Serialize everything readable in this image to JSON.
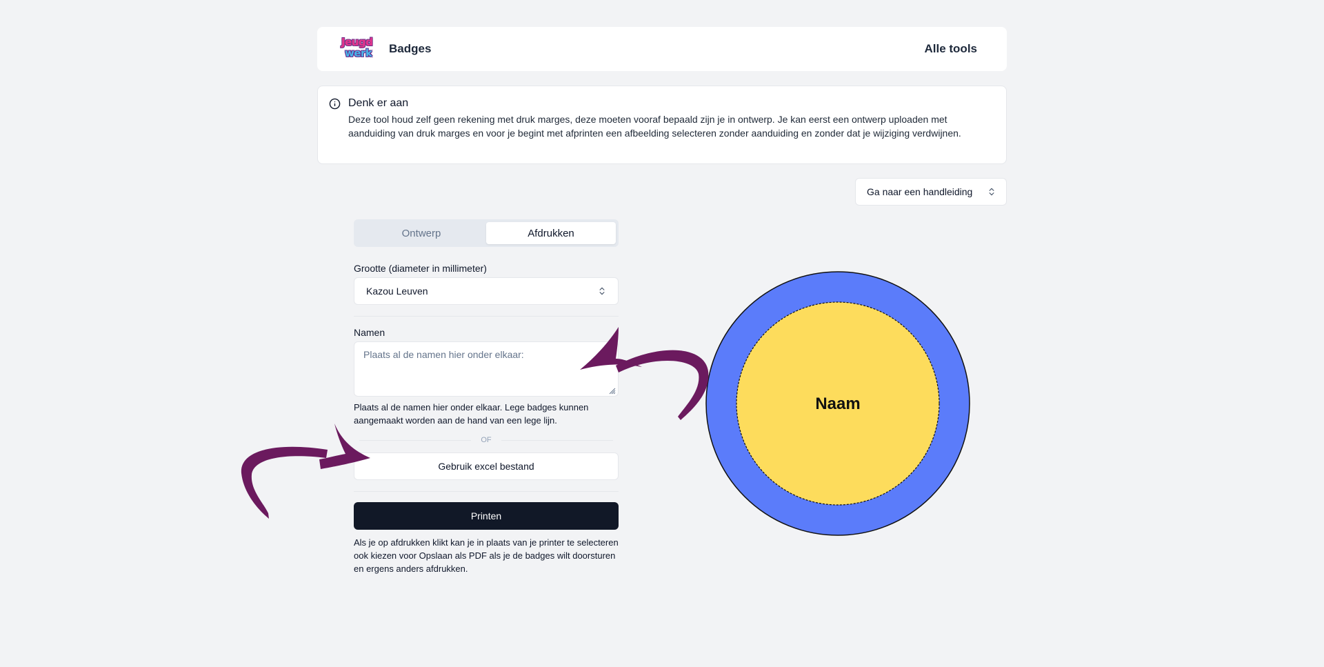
{
  "header": {
    "logo": {
      "line1": "Jeugd",
      "line2": "werk"
    },
    "title": "Badges",
    "nav_link": "Alle tools"
  },
  "notice": {
    "icon": "info-circle-icon",
    "title": "Denk er aan",
    "body": "Deze tool houd zelf geen rekening met druk marges, deze moeten vooraf bepaald zijn je in ontwerp. Je kan eerst een ontwerp uploaden met aanduiding van druk marges en voor je begint met afprinten een afbeelding selecteren zonder aanduiding en zonder dat je wijziging verdwijnen."
  },
  "guide_select": {
    "value": "Ga naar een handleiding",
    "icon": "chevron-up-down-icon"
  },
  "tabs": [
    {
      "label": "Ontwerp",
      "active": false
    },
    {
      "label": "Afdrukken",
      "active": true
    }
  ],
  "form": {
    "size_label": "Grootte (diameter in millimeter)",
    "size_value": "Kazou Leuven",
    "names_label": "Namen",
    "names_placeholder": "Plaats al de namen hier onder elkaar:",
    "names_value": "",
    "names_help": "Plaats al de namen hier onder elkaar. Lege badges kunnen aangemaakt worden aan de hand van een lege lijn.",
    "or_text": "OF",
    "excel_button": "Gebruik excel bestand",
    "print_button": "Printen",
    "print_help": "Als je op afdrukken klikt kan je in plaats van je printer te selecteren ook kiezen voor Opslaan als PDF als je de badges wilt doorsturen en ergens anders afdrukken."
  },
  "badge": {
    "text": "Naam",
    "outer_color": "#5b7cfa",
    "inner_color": "#fddc5c"
  },
  "colors": {
    "arrow": "#6b1a5e",
    "primary_button": "#111827",
    "background": "#f2f3f5"
  }
}
